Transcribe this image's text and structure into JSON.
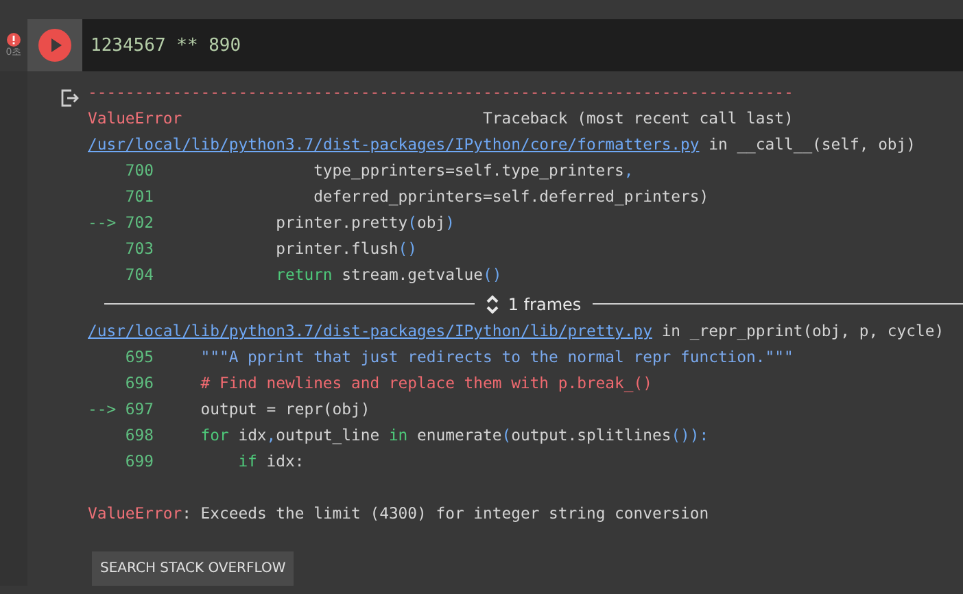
{
  "cell": {
    "error": true,
    "time": "0초",
    "code": "1234567 ** 890"
  },
  "output": {
    "separator": "---------------------------------------------------------------------------",
    "error_name": "ValueError",
    "traceback_title": "Traceback (most recent call last)",
    "blocks": [
      {
        "kind": "frame",
        "file": "/usr/local/lib/python3.7/dist-packages/IPython/core/formatters.py",
        "func": " in __call__(self, obj)",
        "lines": [
          {
            "number": "700",
            "tokens": [
              {
                "text": "                 type_pprinters=self.type_printers",
                "kind": "plain"
              },
              {
                "text": ",",
                "kind": "punct"
              }
            ]
          },
          {
            "number": "701",
            "tokens": [
              {
                "text": "                 deferred_pprinters=self.deferred_printers)",
                "kind": "plain"
              }
            ]
          },
          {
            "number": "702",
            "arrow": "-->",
            "tokens": [
              {
                "text": "             printer.pretty",
                "kind": "plain"
              },
              {
                "text": "(",
                "kind": "punct"
              },
              {
                "text": "obj",
                "kind": "plain"
              },
              {
                "text": ")",
                "kind": "punct"
              }
            ]
          },
          {
            "number": "703",
            "tokens": [
              {
                "text": "             printer.flush",
                "kind": "plain"
              },
              {
                "text": "()",
                "kind": "punct"
              }
            ]
          },
          {
            "number": "704",
            "tokens": [
              {
                "text": "             return",
                "kind": "keyword"
              },
              {
                "text": " stream.getvalue",
                "kind": "plain"
              },
              {
                "text": "()",
                "kind": "punct"
              }
            ]
          }
        ]
      },
      {
        "kind": "collapsed",
        "label": "1 frames"
      },
      {
        "kind": "frame",
        "file": "/usr/local/lib/python3.7/dist-packages/IPython/lib/pretty.py",
        "func": " in _repr_pprint(obj, p, cycle)",
        "lines": [
          {
            "number": "695",
            "tokens": [
              {
                "text": "     \"\"\"A pprint that just redirects to the normal repr function.\"\"\"",
                "kind": "string"
              }
            ]
          },
          {
            "number": "696",
            "tokens": [
              {
                "text": "     # Find newlines and replace them with p.break_()",
                "kind": "comment"
              }
            ]
          },
          {
            "number": "697",
            "arrow": "-->",
            "tokens": [
              {
                "text": "     output = repr(obj)",
                "kind": "plain"
              }
            ]
          },
          {
            "number": "698",
            "tokens": [
              {
                "text": "     for",
                "kind": "keyword"
              },
              {
                "text": " idx",
                "kind": "plain"
              },
              {
                "text": ",",
                "kind": "punct"
              },
              {
                "text": "output_line ",
                "kind": "plain"
              },
              {
                "text": "in",
                "kind": "keyword"
              },
              {
                "text": " enumerate",
                "kind": "plain"
              },
              {
                "text": "(",
                "kind": "punct"
              },
              {
                "text": "output.splitlines",
                "kind": "plain"
              },
              {
                "text": "()):",
                "kind": "punct"
              }
            ]
          },
          {
            "number": "699",
            "tokens": [
              {
                "text": "         if",
                "kind": "keyword"
              },
              {
                "text": " idx:",
                "kind": "plain"
              }
            ]
          }
        ]
      }
    ],
    "final_error": {
      "name": "ValueError",
      "message": ": Exceeds the limit (4300) for integer string conversion"
    },
    "button": "SEARCH STACK OVERFLOW"
  }
}
